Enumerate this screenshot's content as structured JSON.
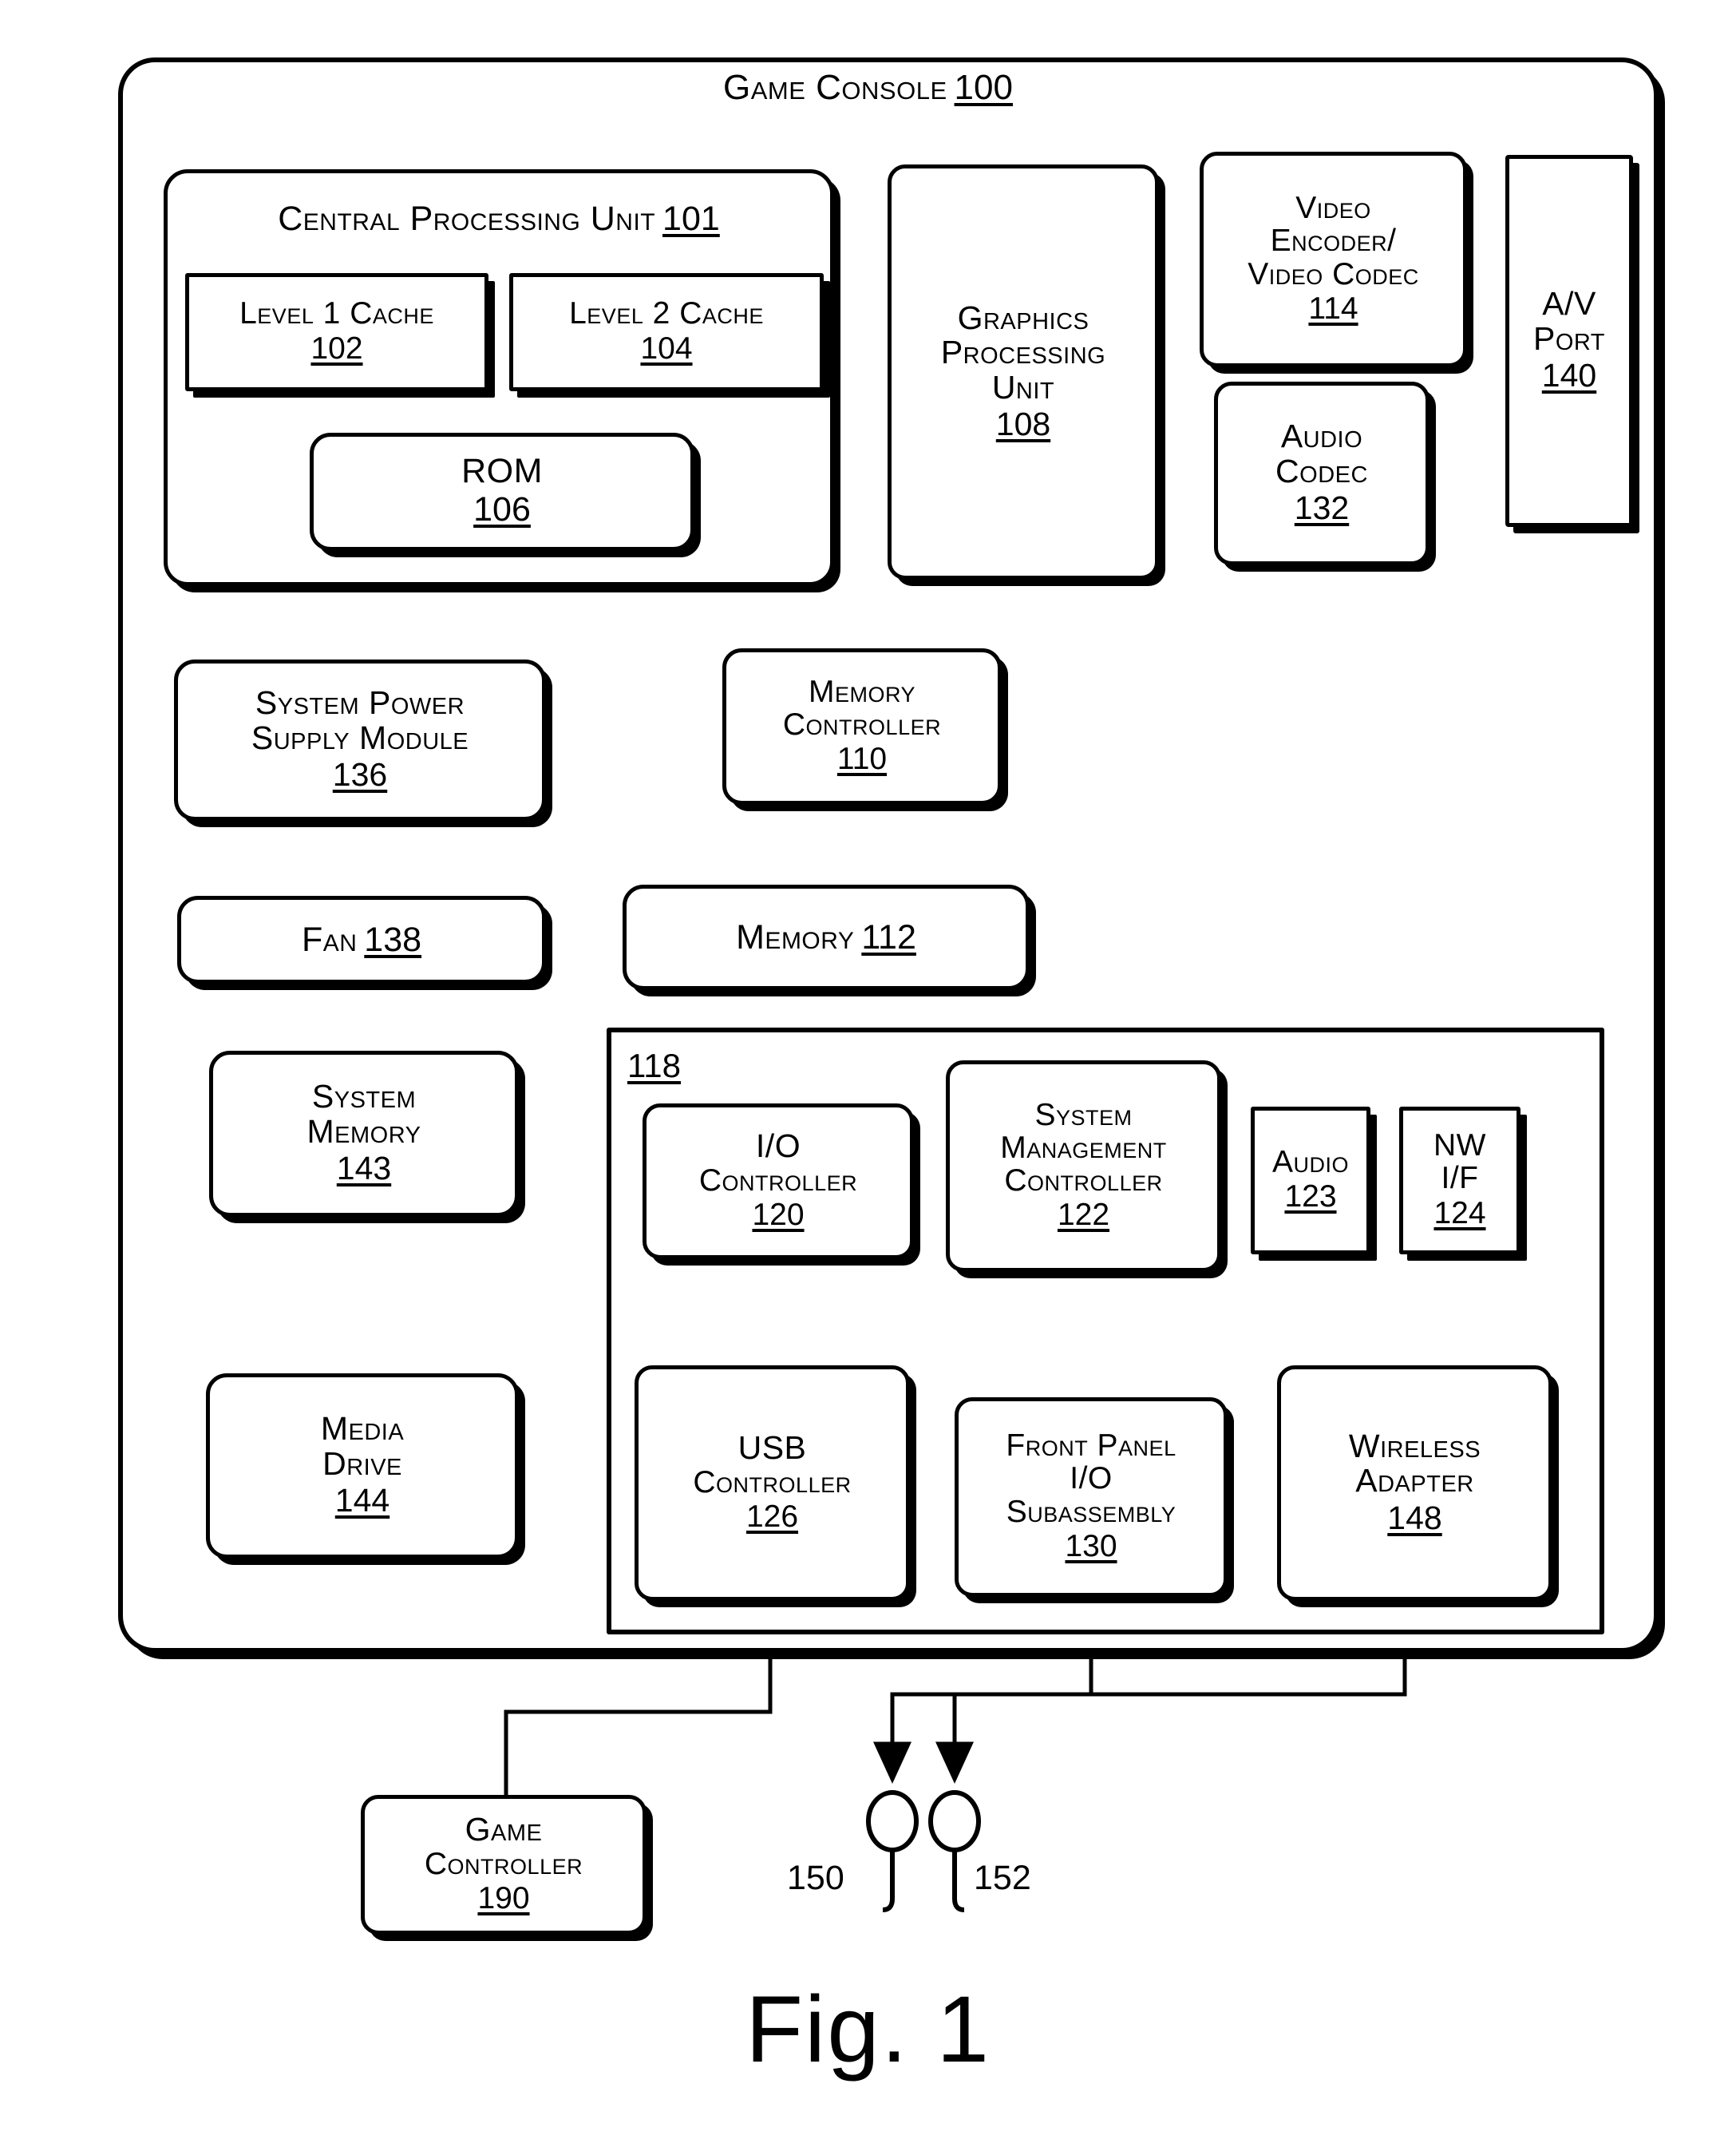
{
  "figure": {
    "caption": "Fig. 1",
    "console": {
      "title": "Game Console",
      "ref": "100"
    }
  },
  "blocks": {
    "cpu": {
      "title": "Central Processing Unit",
      "ref": "101"
    },
    "l1_cache": {
      "title": "Level 1 Cache",
      "ref": "102"
    },
    "l2_cache": {
      "title": "Level 2 Cache",
      "ref": "104"
    },
    "rom": {
      "title": "ROM",
      "ref": "106"
    },
    "gpu": {
      "line1": "Graphics",
      "line2": "Processing",
      "line3": "Unit",
      "ref": "108"
    },
    "video_encoder": {
      "line1": "Video",
      "line2": "Encoder/",
      "line3": "Video Codec",
      "ref": "114"
    },
    "av_port": {
      "line1": "A/V",
      "line2": "Port",
      "ref": "140"
    },
    "audio_codec": {
      "line1": "Audio",
      "line2": "Codec",
      "ref": "132"
    },
    "power_supply": {
      "line1": "System Power",
      "line2": "Supply Module",
      "ref": "136"
    },
    "fan": {
      "title": "Fan",
      "ref": "138"
    },
    "memory_controller": {
      "line1": "Memory",
      "line2": "Controller",
      "ref": "110"
    },
    "memory": {
      "title": "Memory",
      "ref": "112"
    },
    "system_memory": {
      "line1": "System",
      "line2": "Memory",
      "ref": "143"
    },
    "media_drive": {
      "line1": "Media",
      "line2": "Drive",
      "ref": "144"
    },
    "io_hub": {
      "ref": "118"
    },
    "io_controller": {
      "line1": "I/O",
      "line2": "Controller",
      "ref": "120"
    },
    "system_management_controller": {
      "line1": "System",
      "line2": "Management",
      "line3": "Controller",
      "ref": "122"
    },
    "audio": {
      "title": "Audio",
      "ref": "123"
    },
    "nw_if": {
      "line1": "NW",
      "line2": "I/F",
      "ref": "124"
    },
    "usb_controller": {
      "line1": "USB",
      "line2": "Controller",
      "ref": "126"
    },
    "front_panel_io": {
      "line1": "Front Panel",
      "line2": "I/O",
      "line3": "Subassembly",
      "ref": "130"
    },
    "wireless_adapter": {
      "line1": "Wireless",
      "line2": "Adapter",
      "ref": "148"
    },
    "game_controller": {
      "line1": "Game",
      "line2": "Controller",
      "ref": "190"
    }
  },
  "callouts": {
    "port_150": "150",
    "port_152": "152"
  },
  "colors": {
    "line": "#000000",
    "background": "#ffffff"
  }
}
